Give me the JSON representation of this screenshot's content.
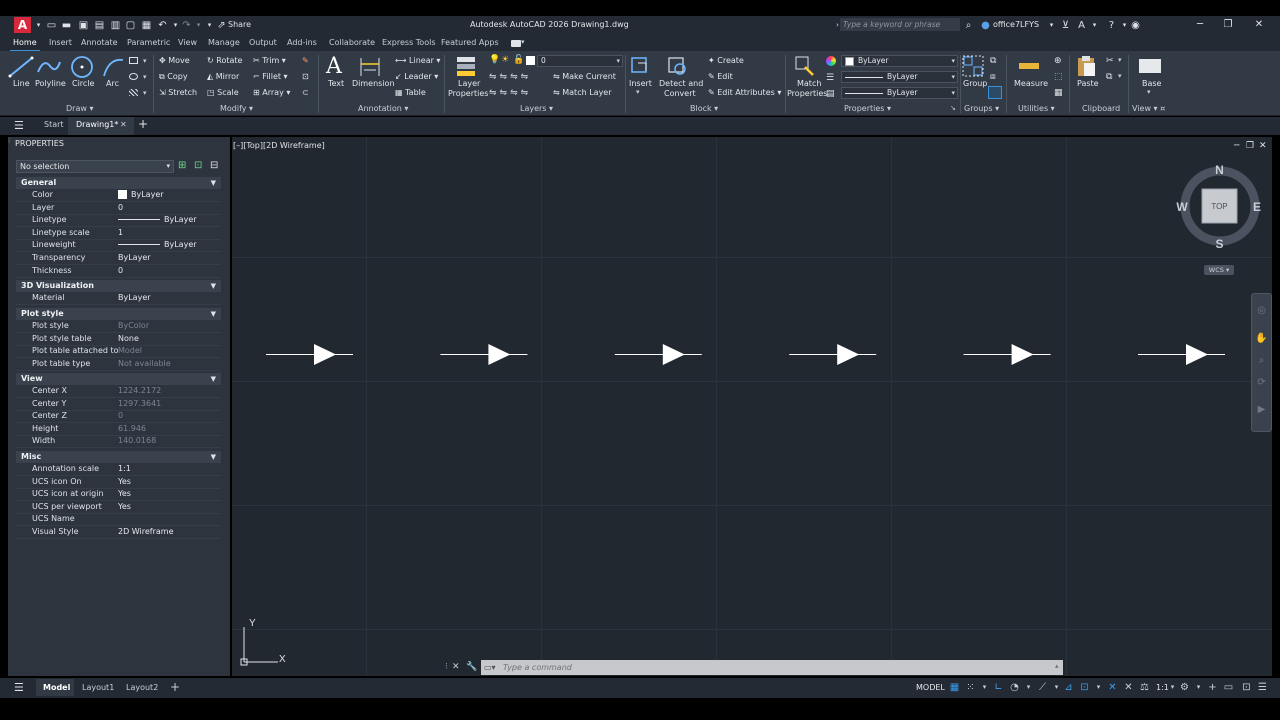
{
  "app": {
    "window_title": "Autodesk AutoCAD 2026   Drawing1.dwg",
    "logo_letter": "A",
    "share_label": "Share",
    "search_placeholder": "Type a keyword or phrase",
    "user_name": "office7LFYS"
  },
  "ribbon_tabs": [
    "Home",
    "Insert",
    "Annotate",
    "Parametric",
    "View",
    "Manage",
    "Output",
    "Add-ins",
    "Collaborate",
    "Express Tools",
    "Featured Apps"
  ],
  "ribbon": {
    "draw": {
      "title": "Draw",
      "line": "Line",
      "polyline": "Polyline",
      "circle": "Circle",
      "arc": "Arc"
    },
    "modify": {
      "title": "Modify",
      "move": "Move",
      "rotate": "Rotate",
      "trim": "Trim",
      "copy": "Copy",
      "mirror": "Mirror",
      "fillet": "Fillet",
      "stretch": "Stretch",
      "scale": "Scale",
      "array": "Array"
    },
    "annotation": {
      "title": "Annotation",
      "text": "Text",
      "dimension": "Dimension",
      "linear": "Linear",
      "leader": "Leader",
      "table": "Table"
    },
    "layers": {
      "title": "Layers",
      "layer_properties_1": "Layer",
      "layer_properties_2": "Properties",
      "current_layer": "0",
      "make_current": "Make Current",
      "match_layer": "Match Layer"
    },
    "insert": {
      "label": "Insert"
    },
    "block": {
      "title": "Block",
      "detect_1": "Detect and",
      "detect_2": "Convert",
      "create": "Create",
      "edit": "Edit",
      "edit_attributes": "Edit Attributes"
    },
    "properties": {
      "title": "Properties",
      "match_1": "Match",
      "match_2": "Properties",
      "color": "ByLayer",
      "linetype": "ByLayer",
      "lineweight": "ByLayer"
    },
    "groups": {
      "title": "Groups",
      "group": "Group"
    },
    "utilities": {
      "title": "Utilities",
      "measure": "Measure"
    },
    "clipboard": {
      "title": "Clipboard",
      "paste": "Paste"
    },
    "view": {
      "title": "View",
      "base": "Base"
    }
  },
  "file_tabs": {
    "start": "Start",
    "drawing": "Drawing1*"
  },
  "palette": {
    "title": "PROPERTIES",
    "selection": "No selection",
    "sections": {
      "general": "General",
      "viz": "3D Visualization",
      "plot": "Plot style",
      "view": "View",
      "misc": "Misc"
    },
    "general": [
      {
        "name": "Color",
        "value": "ByLayer"
      },
      {
        "name": "Layer",
        "value": "0"
      },
      {
        "name": "Linetype",
        "value": "ByLayer"
      },
      {
        "name": "Linetype scale",
        "value": "1"
      },
      {
        "name": "Lineweight",
        "value": "ByLayer"
      },
      {
        "name": "Transparency",
        "value": "ByLayer"
      },
      {
        "name": "Thickness",
        "value": "0"
      }
    ],
    "viz": [
      {
        "name": "Material",
        "value": "ByLayer"
      }
    ],
    "plot": [
      {
        "name": "Plot style",
        "value": "ByColor"
      },
      {
        "name": "Plot style table",
        "value": "None"
      },
      {
        "name": "Plot table attached to",
        "value": "Model"
      },
      {
        "name": "Plot table type",
        "value": "Not available"
      }
    ],
    "view": [
      {
        "name": "Center X",
        "value": "1224.2172"
      },
      {
        "name": "Center Y",
        "value": "1297.3641"
      },
      {
        "name": "Center Z",
        "value": "0"
      },
      {
        "name": "Height",
        "value": "61.946"
      },
      {
        "name": "Width",
        "value": "140.0168"
      }
    ],
    "misc": [
      {
        "name": "Annotation scale",
        "value": "1:1"
      },
      {
        "name": "UCS icon On",
        "value": "Yes"
      },
      {
        "name": "UCS icon at origin",
        "value": "Yes"
      },
      {
        "name": "UCS per viewport",
        "value": "Yes"
      },
      {
        "name": "UCS Name",
        "value": ""
      },
      {
        "name": "Visual Style",
        "value": "2D Wireframe"
      }
    ]
  },
  "viewport": {
    "label": "[–][Top][2D Wireframe]",
    "viewcube": {
      "top": "TOP",
      "n": "N",
      "s": "S",
      "e": "E",
      "w": "W"
    },
    "wcs": "WCS",
    "ucs_x": "X",
    "ucs_y": "Y",
    "arrow_count": 6
  },
  "command": {
    "placeholder": "Type a command"
  },
  "status": {
    "model_tab": "Model",
    "layout1": "Layout1",
    "layout2": "Layout2",
    "model_label": "MODEL",
    "scale": "1:1"
  },
  "colors": {
    "accent": "#3a8fd9",
    "canvas": "#212830",
    "ribbon": "#323a45",
    "logo": "#d8283c"
  }
}
